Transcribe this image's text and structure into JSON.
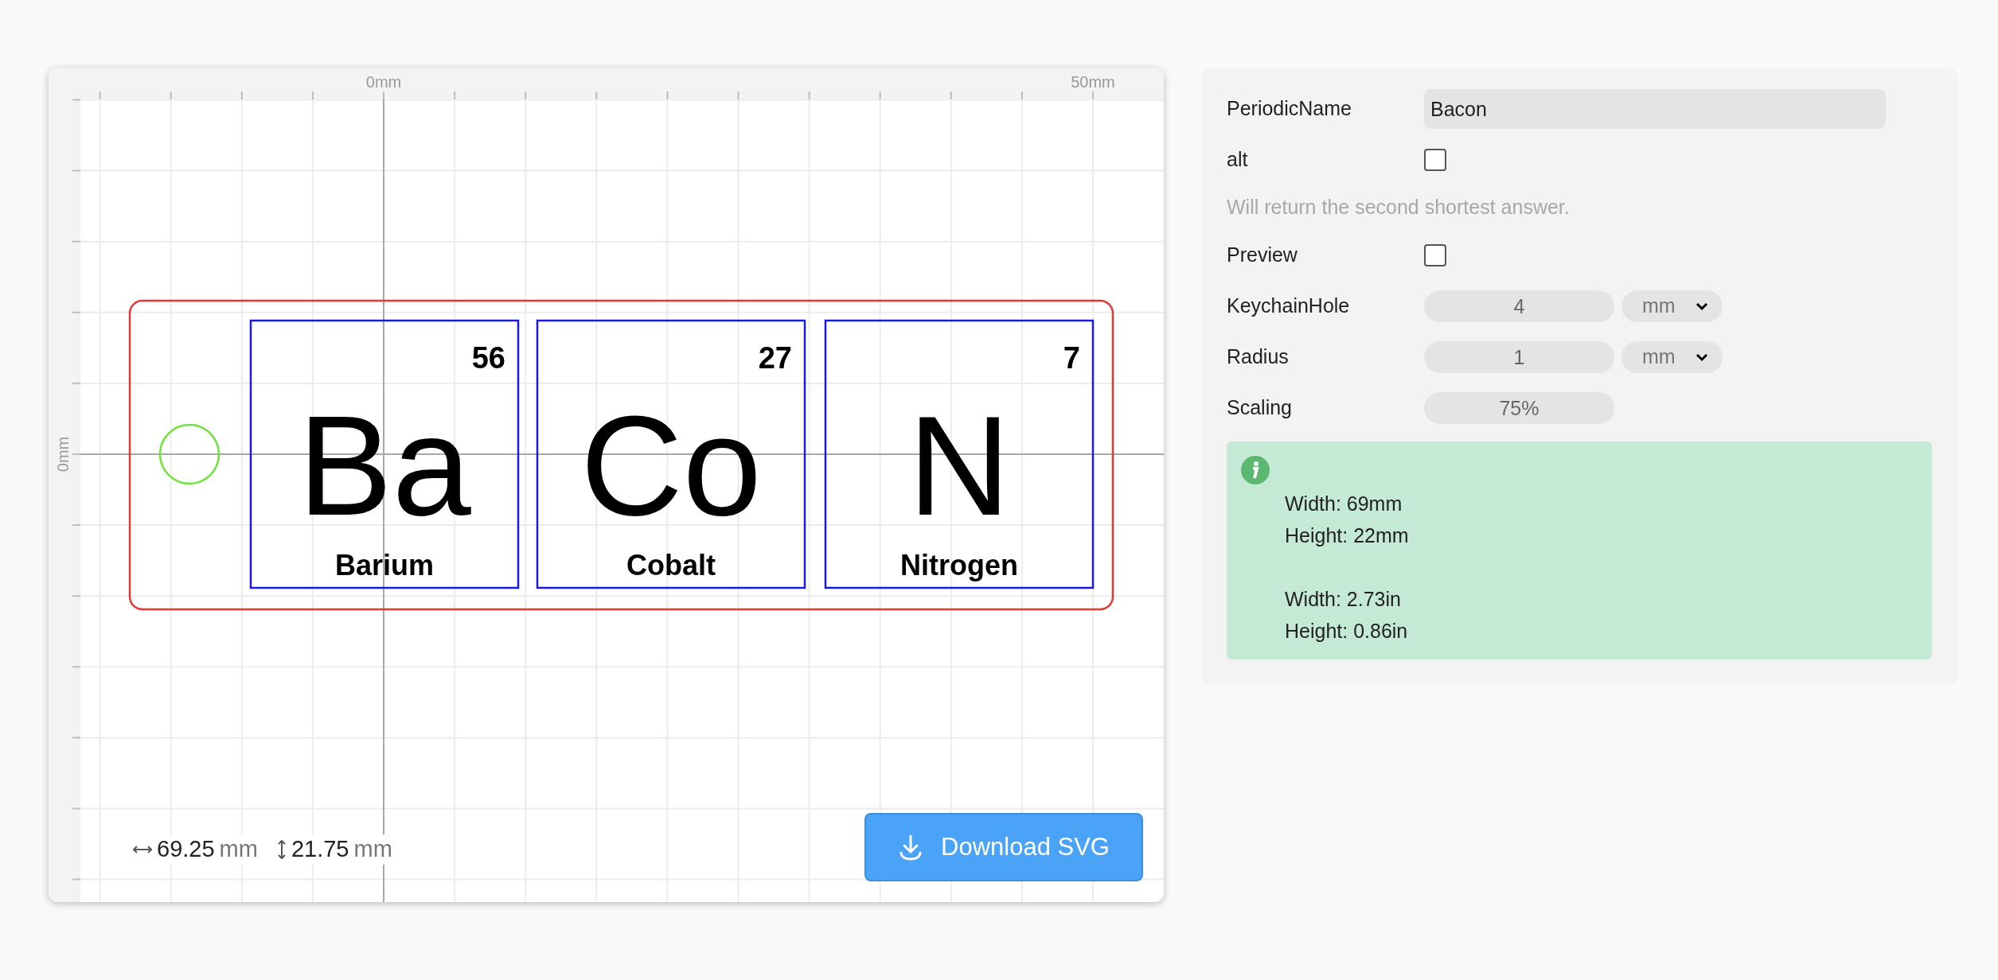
{
  "canvas": {
    "ruler_top_labels": [
      "0mm",
      "50mm"
    ],
    "ruler_left_label": "0mm",
    "elements": [
      {
        "symbol": "Ba",
        "number": "56",
        "name": "Barium"
      },
      {
        "symbol": "Co",
        "number": "27",
        "name": "Cobalt"
      },
      {
        "symbol": "N",
        "number": "7",
        "name": "Nitrogen"
      }
    ],
    "dimensions": {
      "width_value": "69.25",
      "width_unit": "mm",
      "height_value": "21.75",
      "height_unit": "mm"
    },
    "download_button": "Download SVG"
  },
  "settings": {
    "fields": [
      {
        "kind": "text",
        "label": "PeriodicName",
        "value": "Bacon"
      },
      {
        "kind": "checkbox",
        "label": "alt",
        "checked": false,
        "hint": "Will return the second shortest answer."
      },
      {
        "kind": "checkbox",
        "label": "Preview",
        "checked": false
      },
      {
        "kind": "number",
        "label": "KeychainHole",
        "value": "4",
        "unit": "mm"
      },
      {
        "kind": "number",
        "label": "Radius",
        "value": "1",
        "unit": "mm"
      },
      {
        "kind": "number",
        "label": "Scaling",
        "value": "75%"
      }
    ],
    "info": [
      [
        "Width: 69mm",
        "Height: 22mm"
      ],
      [
        "Width: 2.73in",
        "Height: 0.86in"
      ]
    ]
  }
}
